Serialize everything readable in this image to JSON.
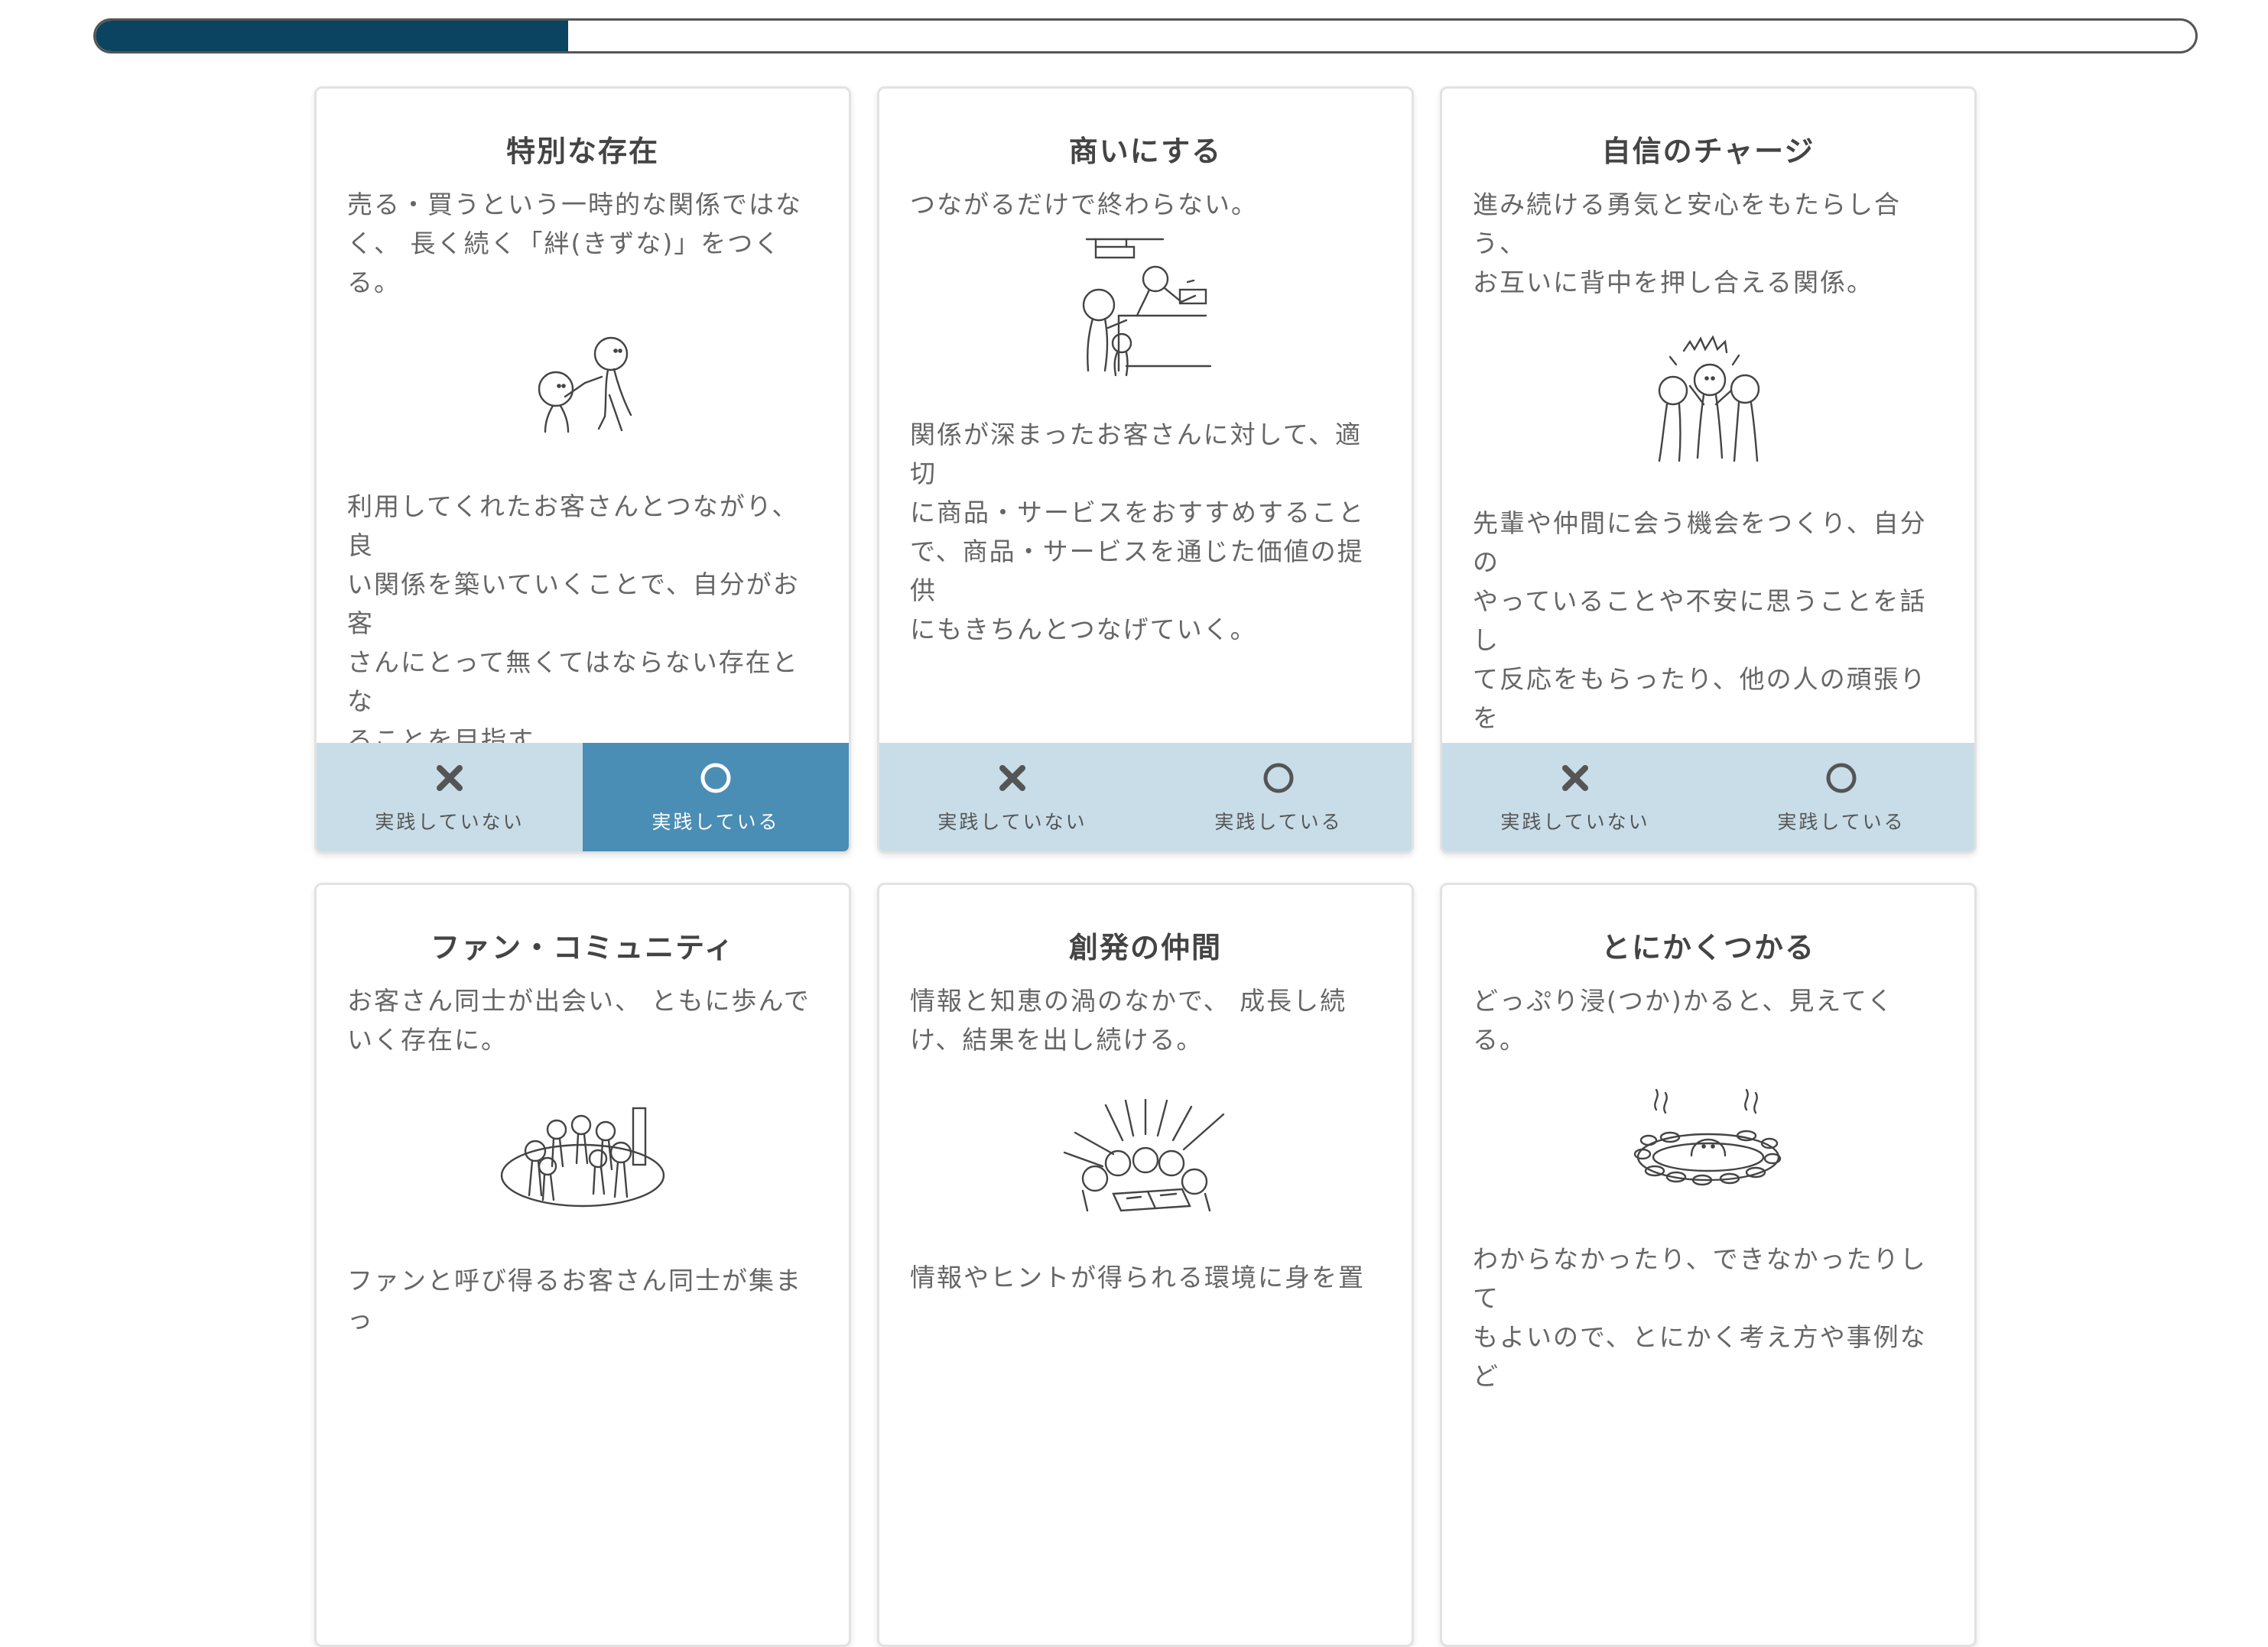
{
  "progress": {
    "value": 0.225
  },
  "colors": {
    "progress_fill": "#0b4460",
    "choice_bar": "#c8dde8",
    "selected": "#4a8db5"
  },
  "choice_labels": {
    "no": "実践していない",
    "yes": "実践している"
  },
  "cards": [
    {
      "title": "特別な存在",
      "lead": "売る・買うという一時的な関係ではな\nく、 長く続く「絆(きずな)」をつく\nる。",
      "body": "利用してくれたお客さんとつながり、良\nい関係を築いていくことで、自分がお客\nさんにとって無くてはならない存在とな\nることを目指す。",
      "illustration": "handshake-illustration",
      "selected": "yes"
    },
    {
      "title": "商いにする",
      "lead": "つながるだけで終わらない。",
      "body": "関係が深まったお客さんに対して、適切\nに商品・サービスをおすすめすること\nで、商品・サービスを通じた価値の提供\nにもきちんとつなげていく。",
      "illustration": "shop-counter-illustration",
      "selected": null
    },
    {
      "title": "自信のチャージ",
      "lead": "進み続ける勇気と安心をもたらし合う、\nお互いに背中を押し合える関係。",
      "body": "先輩や仲間に会う機会をつくり、自分の\nやっていることや不安に思うことを話し\nて反応をもらったり、他の人の頑張りを\n聞いたりして、勇気をもらいに行く。",
      "illustration": "cheering-group-illustration",
      "selected": null
    },
    {
      "title": "ファン・コミュニティ",
      "lead": "お客さん同士が出会い、 ともに歩んで\nいく存在に。",
      "body": "ファンと呼び得るお客さん同士が集まっ",
      "illustration": "community-gathering-illustration",
      "selected": null
    },
    {
      "title": "創発の仲間",
      "lead": "情報と知恵の渦のなかで、 成長し続\nけ、結果を出し続ける。",
      "body": "情報やヒントが得られる環境に身を置",
      "illustration": "brainstorm-group-illustration",
      "selected": null
    },
    {
      "title": "とにかくつかる",
      "lead": "どっぷり浸(つか)かると、見えてくる。",
      "body": "わからなかったり、できなかったりして\nもよいので、とにかく考え方や事例など",
      "illustration": "hot-spring-illustration",
      "selected": null
    }
  ]
}
